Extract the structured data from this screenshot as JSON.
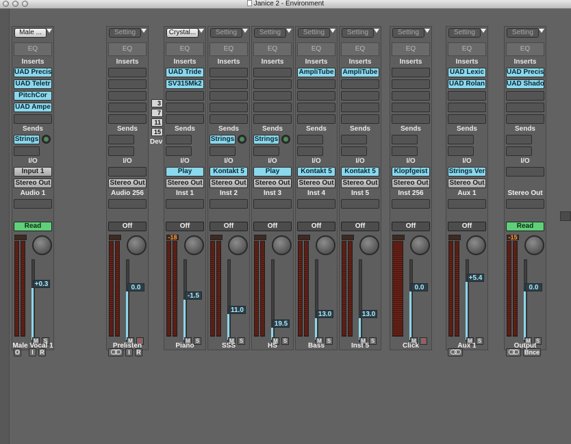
{
  "window": {
    "title": "Janice 2 - Environment"
  },
  "section_labels": {
    "eq": "EQ",
    "inserts": "Inserts",
    "sends": "Sends",
    "io": "I/O"
  },
  "mute_label": "M",
  "solo_label": "S",
  "dev": {
    "label": "Dev",
    "items": [
      "3",
      "7",
      "11",
      "15"
    ]
  },
  "colors": {
    "accent_cyan": "#8bd8ec",
    "read_green": "#5fcf7a",
    "background": "#626262"
  },
  "channels": [
    {
      "id": "male",
      "header": "Male ...",
      "header_style": "light",
      "inserts": [
        "UAD Precis",
        "UAD Teletr",
        "PitchCor",
        "UAD Ampe"
      ],
      "send": "Strings",
      "send_knob": true,
      "input": "Input 1",
      "output": "Stereo Out",
      "track": "Audio 1",
      "automation": "Read",
      "peak": "",
      "fader": "+0.3",
      "fader_level": 0.64,
      "meter_count": 2,
      "solo_active": false,
      "bottom": [
        "O",
        "I",
        "R"
      ],
      "name": "Male   Vocal 1"
    },
    {
      "id": "prelisten",
      "header": "Setting",
      "header_style": "dark",
      "inserts": [],
      "send": "",
      "send_knob": false,
      "input": "",
      "output": "Stereo Out",
      "track": "Audio 256",
      "automation": "Off",
      "peak": "",
      "fader": "0.0",
      "fader_level": 0.6,
      "meter_count": 2,
      "solo_active": true,
      "bottom": [
        "link",
        "I",
        "R"
      ],
      "name": "Prelisten"
    },
    {
      "id": "piano",
      "header": "Crystal...",
      "header_style": "light",
      "inserts": [
        "UAD Tride",
        "SV315Mk2"
      ],
      "send": "",
      "send_knob": false,
      "input": "Play",
      "output": "Stereo Out",
      "track": "Inst 1",
      "automation": "Off",
      "peak": "-18",
      "fader": "-1.5",
      "fader_level": 0.5,
      "meter_count": 2,
      "solo_active": false,
      "bottom": [],
      "name": "Piano"
    },
    {
      "id": "sss",
      "header": "Setting",
      "header_style": "dark",
      "inserts": [],
      "send": "Strings",
      "send_knob": true,
      "input": "Kontakt 5",
      "output": "Stereo Out",
      "track": "Inst 2",
      "automation": "Off",
      "peak": "",
      "fader": "11.0",
      "fader_level": 0.32,
      "meter_count": 2,
      "solo_active": false,
      "bottom": [],
      "name": "SSS"
    },
    {
      "id": "hs",
      "header": "Setting",
      "header_style": "dark",
      "inserts": [],
      "send": "Strings",
      "send_knob": true,
      "input": "Play",
      "output": "Stereo Out",
      "track": "Inst 3",
      "automation": "Off",
      "peak": "",
      "fader": "19.5",
      "fader_level": 0.15,
      "meter_count": 2,
      "solo_active": false,
      "bottom": [],
      "name": "HS"
    },
    {
      "id": "bass",
      "header": "Setting",
      "header_style": "dark",
      "inserts": [
        "AmpliTube"
      ],
      "send": "",
      "send_knob": false,
      "input": "Kontakt 5",
      "output": "Stereo Out",
      "track": "Inst 4",
      "automation": "Off",
      "peak": "",
      "fader": "13.0",
      "fader_level": 0.27,
      "meter_count": 2,
      "solo_active": false,
      "bottom": [],
      "name": "Bass"
    },
    {
      "id": "inst5",
      "header": "Setting",
      "header_style": "dark",
      "inserts": [
        "AmpliTube"
      ],
      "send": "",
      "send_knob": false,
      "input": "Kontakt 5",
      "output": "Stereo Out",
      "track": "Inst 5",
      "automation": "Off",
      "peak": "",
      "fader": "13.0",
      "fader_level": 0.27,
      "meter_count": 2,
      "solo_active": false,
      "bottom": [],
      "name": "Inst 5"
    },
    {
      "id": "click",
      "header": "Setting",
      "header_style": "dark",
      "inserts": [],
      "send": "",
      "send_knob": false,
      "input": "Klopfgeist",
      "output": "Stereo Out",
      "track": "Inst 256",
      "automation": "Off",
      "peak": "",
      "fader": "0.0",
      "fader_level": 0.6,
      "meter_count": 1,
      "solo_active": true,
      "bottom": [],
      "name": "Click"
    },
    {
      "id": "aux1",
      "header": "Setting",
      "header_style": "dark",
      "inserts": [
        "UAD Lexic",
        "UAD Rolan"
      ],
      "send": "",
      "send_knob": false,
      "input": "Strings Ver",
      "output": "Stereo Out",
      "track": "Aux 1",
      "automation": "Off",
      "peak": "",
      "fader": "+5.4",
      "fader_level": 0.72,
      "meter_count": 2,
      "solo_active": false,
      "bottom": [
        "link"
      ],
      "name": "Aux 1"
    },
    {
      "id": "output",
      "header": "Setting",
      "header_style": "dark",
      "inserts": [
        "UAD Precis",
        "UAD Shado"
      ],
      "send": "",
      "send_knob": false,
      "input": "",
      "output": "",
      "track": "Stereo Out",
      "automation": "Read",
      "peak": "-15",
      "fader": "0.0",
      "fader_level": 0.6,
      "meter_count": 2,
      "solo_active": false,
      "bottom": [
        "link",
        "Bnce"
      ],
      "name": "Output"
    }
  ]
}
